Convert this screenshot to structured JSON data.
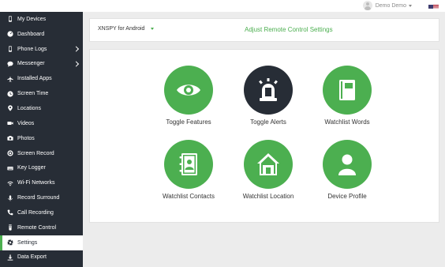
{
  "header": {
    "user_name": "Demo Demo",
    "flag_icon": "us-flag-icon"
  },
  "sidebar": {
    "items": [
      {
        "label": "My Devices",
        "icon": "phone-icon"
      },
      {
        "label": "Dashboard",
        "icon": "dashboard-icon"
      },
      {
        "label": "Phone Logs",
        "icon": "phone-icon",
        "expandable": true
      },
      {
        "label": "Messenger",
        "icon": "chat-icon",
        "expandable": true
      },
      {
        "label": "Installed Apps",
        "icon": "airplane-icon"
      },
      {
        "label": "Screen Time",
        "icon": "clock-icon"
      },
      {
        "label": "Locations",
        "icon": "location-icon"
      },
      {
        "label": "Videos",
        "icon": "video-icon"
      },
      {
        "label": "Photos",
        "icon": "camera-icon"
      },
      {
        "label": "Screen Record",
        "icon": "record-icon"
      },
      {
        "label": "Key Logger",
        "icon": "keyboard-icon"
      },
      {
        "label": "Wi-Fi Networks",
        "icon": "wifi-icon"
      },
      {
        "label": "Record Surround",
        "icon": "microphone-icon"
      },
      {
        "label": "Call Recording",
        "icon": "call-icon"
      },
      {
        "label": "Remote Control",
        "icon": "remote-icon"
      },
      {
        "label": "Settings",
        "icon": "gear-icon",
        "active": true
      },
      {
        "label": "Data Export",
        "icon": "download-icon"
      }
    ]
  },
  "settings_bar": {
    "device": "XNSPY for Android",
    "title": "Adjust Remote Control Settings"
  },
  "cards": [
    {
      "label": "Toggle Features",
      "icon": "eye-icon"
    },
    {
      "label": "Toggle Alerts",
      "icon": "siren-icon"
    },
    {
      "label": "Watchlist Words",
      "icon": "book-icon"
    },
    {
      "label": "Watchlist Contacts",
      "icon": "contacts-book-icon"
    },
    {
      "label": "Watchlist Location",
      "icon": "house-icon"
    },
    {
      "label": "Device Profile",
      "icon": "person-icon"
    }
  ],
  "colors": {
    "accent": "#4caf50",
    "sidebar_bg": "#272d36",
    "page_bg": "#ececec"
  }
}
